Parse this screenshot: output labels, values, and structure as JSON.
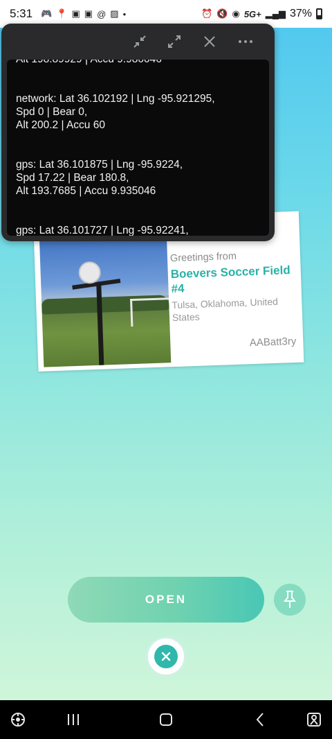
{
  "status_bar": {
    "time": "5:31",
    "network": "5G+",
    "battery": "37%"
  },
  "floating_window": {
    "log_entries": [
      "Alt 198.89929 | Accu 9.980046",
      "network: Lat 36.102192 | Lng -95.921295,\nSpd 0 | Bear 0,\nAlt 200.2 | Accu 60",
      "gps: Lat 36.101875 | Lng -95.9224,\nSpd 17.22 | Bear 180.8,\nAlt 193.7685 | Accu 9.935046",
      "gps: Lat 36.101727 | Lng -95.92241,"
    ]
  },
  "postcard": {
    "greeting": "Greetings from",
    "place": "Boevers Soccer Field #4",
    "location": "Tulsa, Oklahoma, United States",
    "trainer": "AABatt3ry"
  },
  "actions": {
    "open_label": "OPEN"
  },
  "colors": {
    "accent": "#2ab1a7",
    "open_button": "#6fd2b0"
  }
}
